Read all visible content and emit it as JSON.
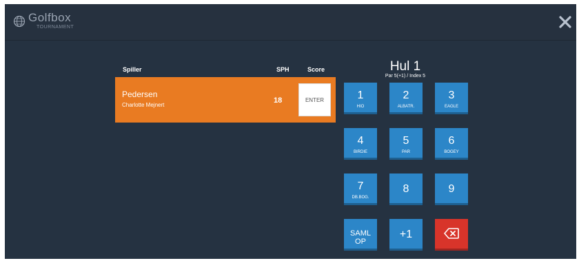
{
  "brand": {
    "name": "Golfbox",
    "subtitle": "TOURNAMENT"
  },
  "table": {
    "headers": {
      "player": "Spiller",
      "sph": "SPH",
      "score": "Score"
    },
    "player": {
      "last_name": "Pedersen",
      "first_name": "Charlotte Mejnert",
      "sph": "18",
      "score_placeholder": "ENTER"
    }
  },
  "hole": {
    "title": "Hul 1",
    "subtitle": "Par 5(+1) / Index 5"
  },
  "keypad": {
    "k1": {
      "num": "1",
      "label": "HIO"
    },
    "k2": {
      "num": "2",
      "label": "ALBATR."
    },
    "k3": {
      "num": "3",
      "label": "EAGLE"
    },
    "k4": {
      "num": "4",
      "label": "BIRDIE"
    },
    "k5": {
      "num": "5",
      "label": "PAR"
    },
    "k6": {
      "num": "6",
      "label": "BOGEY"
    },
    "k7": {
      "num": "7",
      "label": "DB.BOG."
    },
    "k8": {
      "num": "8"
    },
    "k9": {
      "num": "9"
    },
    "collect": "SAML OP",
    "plus_one": "+1"
  },
  "colors": {
    "background": "#253241",
    "player_row": "#e97b22",
    "key": "#2c86c8",
    "delete_key": "#d8342a"
  },
  "icons": {
    "logo": "globe-icon",
    "close": "close-icon",
    "delete": "backspace-icon"
  }
}
